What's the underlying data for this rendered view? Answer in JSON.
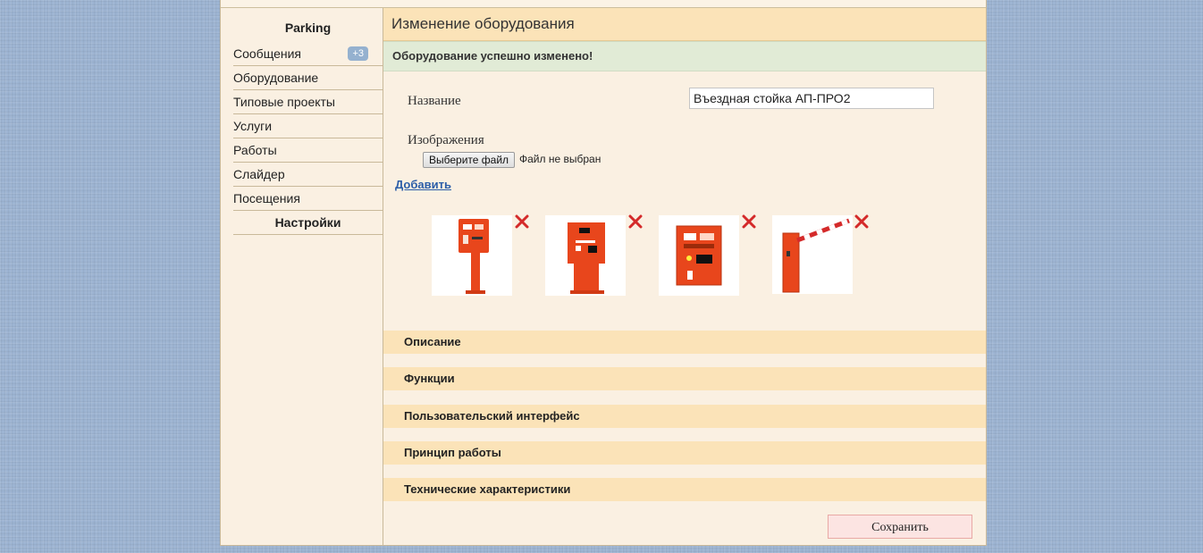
{
  "sidebar": {
    "title": "Parking",
    "items": [
      {
        "label": "Сообщения",
        "badge": "+3"
      },
      {
        "label": "Оборудование"
      },
      {
        "label": "Типовые проекты"
      },
      {
        "label": "Услуги"
      },
      {
        "label": "Работы"
      },
      {
        "label": "Слайдер"
      },
      {
        "label": "Посещения"
      },
      {
        "label": "Настройки"
      }
    ]
  },
  "main": {
    "title": "Изменение оборудования",
    "success_message": "Оборудование успешно изменено!",
    "form": {
      "name_label": "Название",
      "name_value": "Въездная стойка АП-ПРО2",
      "images_label": "Изображения",
      "file_button": "Выберите файл",
      "file_status": "Файл не выбран",
      "add_link": "Добавить"
    },
    "images": [
      {
        "icon": "entry-stand-image"
      },
      {
        "icon": "exit-stand-image"
      },
      {
        "icon": "payment-terminal-image"
      },
      {
        "icon": "barrier-image"
      }
    ],
    "sections": [
      "Описание",
      "Функции",
      "Пользовательский интерфейс",
      "Принцип работы",
      "Технические характеристики"
    ],
    "save_button": "Сохранить"
  },
  "colors": {
    "accent_header": "#fbe3b8",
    "success_bg": "#e1ebd6",
    "device_orange": "#e8461c",
    "delete_red": "#d42a2a",
    "link": "#2c5ea8"
  }
}
